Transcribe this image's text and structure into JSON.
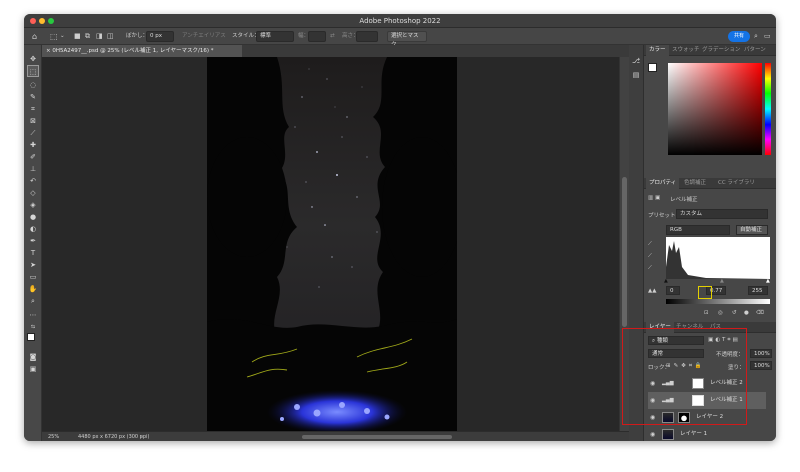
{
  "window": {
    "title": "Adobe Photoshop 2022"
  },
  "options": {
    "feather_label": "ぼかし：",
    "feather_value": "0 px",
    "antialias_label": "アンチエイリアス",
    "style_label": "スタイル：",
    "style_value": "標準",
    "width_label": "幅：",
    "height_label": "高さ：",
    "mask_button": "選択とマスク...",
    "share_button": "共有"
  },
  "document": {
    "tab_label": "0H5A2497__.psd @ 25% (レベル補正 1, レイヤーマスク/16) *",
    "zoom": "25%",
    "doc_info": "4480 px x 6720 px (300 ppi)"
  },
  "color_panel": {
    "tabs": [
      "カラー",
      "スウォッチ",
      "グラデーション",
      "パターン"
    ]
  },
  "properties_panel": {
    "tabs": [
      "プロパティ",
      "色調補正",
      "CC ライブラリ"
    ],
    "header": "レベル補正",
    "preset_label": "プリセット：",
    "preset_value": "カスタム",
    "channel_value": "RGB",
    "auto_button": "自動補正",
    "input_black": "0",
    "input_mid": "0.77",
    "input_white": "255"
  },
  "layers_panel": {
    "tabs": [
      "レイヤー",
      "チャンネル",
      "パス"
    ],
    "filter_value": "種類",
    "blend_mode": "通常",
    "opacity_label": "不透明度：",
    "opacity_value": "100%",
    "lock_label": "ロック：",
    "fill_label": "塗り：",
    "fill_value": "100%",
    "layers": [
      {
        "name": "レベル補正 2",
        "kind": "adjustment"
      },
      {
        "name": "レベル補正 1",
        "kind": "adjustment",
        "selected": true
      },
      {
        "name": "レイヤー 2",
        "kind": "image"
      },
      {
        "name": "レイヤー 1",
        "kind": "image"
      }
    ],
    "bottom_icons": [
      "link-icon",
      "fx-icon",
      "mask-icon",
      "adjustment-icon",
      "folder-icon",
      "new-layer-icon",
      "trash-icon"
    ]
  },
  "colors": {
    "accent": "#1473e6",
    "highlight_red": "#d11a1a",
    "highlight_yellow": "#e3d000",
    "selected_layer": "#5f5f5f"
  }
}
